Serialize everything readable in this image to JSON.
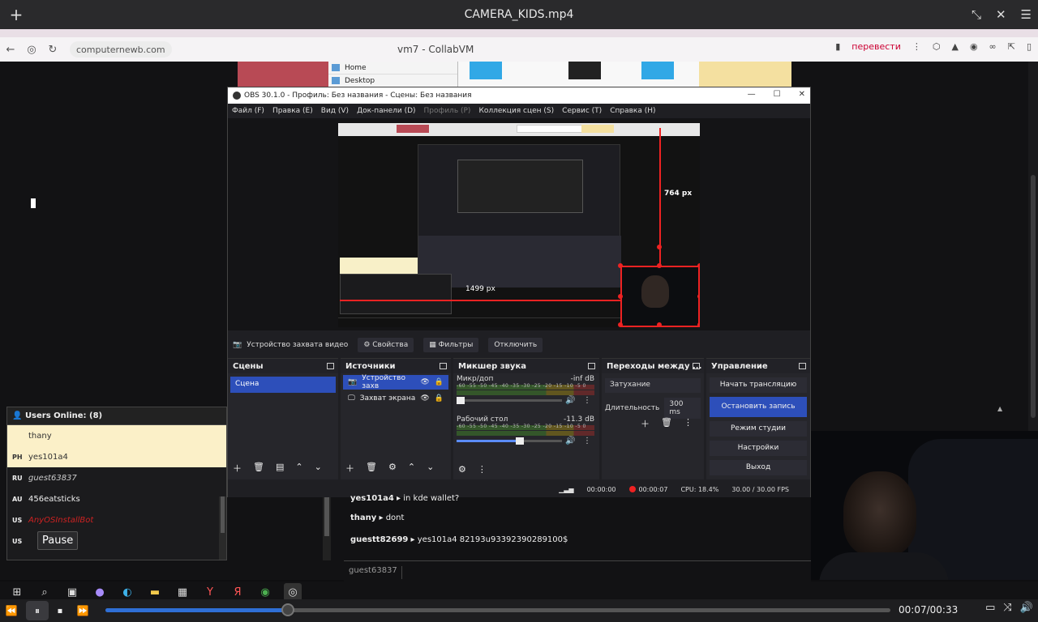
{
  "player": {
    "add_icon": "plus-icon",
    "title": "CAMERA_KIDS.mp4",
    "time": "00:07/00:33",
    "progress_fraction": 0.232,
    "tooltip": "Pause"
  },
  "browser": {
    "url": "computernewb.com",
    "page_title": "vm7 - CollabVM",
    "translate": "перевести"
  },
  "file_manager": {
    "items": [
      "Home",
      "Desktop"
    ]
  },
  "obs": {
    "title": "OBS 30.1.0 - Профиль: Без названия - Сцены: Без названия",
    "menu": [
      {
        "label": "Файл (F)",
        "dim": false
      },
      {
        "label": "Правка (E)",
        "dim": false
      },
      {
        "label": "Вид (V)",
        "dim": false
      },
      {
        "label": "Док-панели (D)",
        "dim": false
      },
      {
        "label": "Профиль (P)",
        "dim": true
      },
      {
        "label": "Коллекция сцен (S)",
        "dim": false
      },
      {
        "label": "Сервис (T)",
        "dim": false
      },
      {
        "label": "Справка (H)",
        "dim": false
      }
    ],
    "preview": {
      "height_label": "764 px",
      "width_label": "1499 px"
    },
    "source_bar": {
      "source": "Устройство захвата видео",
      "properties": "Свойства",
      "filters": "Фильтры",
      "disconnect": "Отключить"
    },
    "scenes": {
      "title": "Сцены",
      "items": [
        "Сцена"
      ]
    },
    "sources": {
      "title": "Источники",
      "items": [
        "Устройство захв",
        "Захват экрана"
      ]
    },
    "mixer": {
      "title": "Микшер звука",
      "channels": [
        {
          "name": "Микр/доп",
          "db": "-inf dB",
          "level": 0.0
        },
        {
          "name": "Рабочий стол",
          "db": "-11.3 dB",
          "level": 0.6
        }
      ],
      "ticks": "-60 -55 -50 -45 -40 -35 -30 -25 -20 -15 -10 -5 0"
    },
    "transitions": {
      "title": "Переходы между ...",
      "type": "Затухание",
      "duration_label": "Длительность",
      "duration": "300 ms"
    },
    "controls": {
      "title": "Управление",
      "buttons": [
        "Начать трансляцию",
        "Остановить запись",
        "Режим студии",
        "Настройки",
        "Выход"
      ]
    },
    "status": {
      "stream_time": "00:00:00",
      "rec_time": "00:00:07",
      "cpu": "CPU: 18.4%",
      "fps": "30.00 / 30.00 FPS"
    }
  },
  "users": {
    "title": "Users Online: (8)",
    "list": [
      {
        "cc": "",
        "name": "thany",
        "style": "hl"
      },
      {
        "cc": "PH",
        "name": "yes101a4",
        "style": "hl"
      },
      {
        "cc": "RU",
        "name": "guest63837",
        "style": "it"
      },
      {
        "cc": "AU",
        "name": "456eatsticks",
        "style": ""
      },
      {
        "cc": "US",
        "name": "AnyOSInstallBot",
        "style": "red"
      },
      {
        "cc": "US",
        "name": "",
        "style": ""
      }
    ]
  },
  "chat": {
    "messages": [
      {
        "user": "yes101a4",
        "text": "in kde wallet?"
      },
      {
        "user": "thany",
        "text": "dont"
      },
      {
        "user": "guestt82699",
        "text": "yes101a4 82193u93392390289100$"
      }
    ],
    "input_username": "guest63837"
  }
}
